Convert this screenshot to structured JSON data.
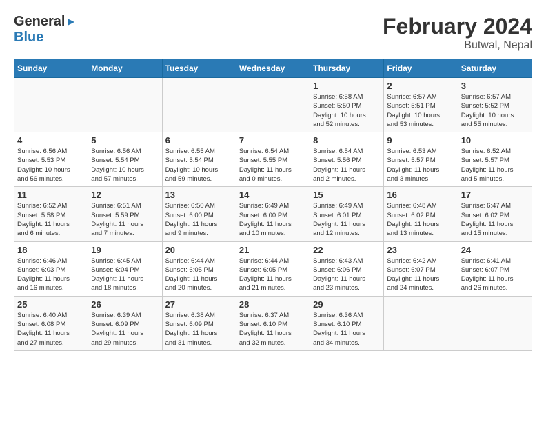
{
  "header": {
    "logo_line1": "General",
    "logo_line2": "Blue",
    "title": "February 2024",
    "subtitle": "Butwal, Nepal"
  },
  "days_of_week": [
    "Sunday",
    "Monday",
    "Tuesday",
    "Wednesday",
    "Thursday",
    "Friday",
    "Saturday"
  ],
  "weeks": [
    [
      {
        "day": "",
        "info": ""
      },
      {
        "day": "",
        "info": ""
      },
      {
        "day": "",
        "info": ""
      },
      {
        "day": "",
        "info": ""
      },
      {
        "day": "1",
        "info": "Sunrise: 6:58 AM\nSunset: 5:50 PM\nDaylight: 10 hours\nand 52 minutes."
      },
      {
        "day": "2",
        "info": "Sunrise: 6:57 AM\nSunset: 5:51 PM\nDaylight: 10 hours\nand 53 minutes."
      },
      {
        "day": "3",
        "info": "Sunrise: 6:57 AM\nSunset: 5:52 PM\nDaylight: 10 hours\nand 55 minutes."
      }
    ],
    [
      {
        "day": "4",
        "info": "Sunrise: 6:56 AM\nSunset: 5:53 PM\nDaylight: 10 hours\nand 56 minutes."
      },
      {
        "day": "5",
        "info": "Sunrise: 6:56 AM\nSunset: 5:54 PM\nDaylight: 10 hours\nand 57 minutes."
      },
      {
        "day": "6",
        "info": "Sunrise: 6:55 AM\nSunset: 5:54 PM\nDaylight: 10 hours\nand 59 minutes."
      },
      {
        "day": "7",
        "info": "Sunrise: 6:54 AM\nSunset: 5:55 PM\nDaylight: 11 hours\nand 0 minutes."
      },
      {
        "day": "8",
        "info": "Sunrise: 6:54 AM\nSunset: 5:56 PM\nDaylight: 11 hours\nand 2 minutes."
      },
      {
        "day": "9",
        "info": "Sunrise: 6:53 AM\nSunset: 5:57 PM\nDaylight: 11 hours\nand 3 minutes."
      },
      {
        "day": "10",
        "info": "Sunrise: 6:52 AM\nSunset: 5:57 PM\nDaylight: 11 hours\nand 5 minutes."
      }
    ],
    [
      {
        "day": "11",
        "info": "Sunrise: 6:52 AM\nSunset: 5:58 PM\nDaylight: 11 hours\nand 6 minutes."
      },
      {
        "day": "12",
        "info": "Sunrise: 6:51 AM\nSunset: 5:59 PM\nDaylight: 11 hours\nand 7 minutes."
      },
      {
        "day": "13",
        "info": "Sunrise: 6:50 AM\nSunset: 6:00 PM\nDaylight: 11 hours\nand 9 minutes."
      },
      {
        "day": "14",
        "info": "Sunrise: 6:49 AM\nSunset: 6:00 PM\nDaylight: 11 hours\nand 10 minutes."
      },
      {
        "day": "15",
        "info": "Sunrise: 6:49 AM\nSunset: 6:01 PM\nDaylight: 11 hours\nand 12 minutes."
      },
      {
        "day": "16",
        "info": "Sunrise: 6:48 AM\nSunset: 6:02 PM\nDaylight: 11 hours\nand 13 minutes."
      },
      {
        "day": "17",
        "info": "Sunrise: 6:47 AM\nSunset: 6:02 PM\nDaylight: 11 hours\nand 15 minutes."
      }
    ],
    [
      {
        "day": "18",
        "info": "Sunrise: 6:46 AM\nSunset: 6:03 PM\nDaylight: 11 hours\nand 16 minutes."
      },
      {
        "day": "19",
        "info": "Sunrise: 6:45 AM\nSunset: 6:04 PM\nDaylight: 11 hours\nand 18 minutes."
      },
      {
        "day": "20",
        "info": "Sunrise: 6:44 AM\nSunset: 6:05 PM\nDaylight: 11 hours\nand 20 minutes."
      },
      {
        "day": "21",
        "info": "Sunrise: 6:44 AM\nSunset: 6:05 PM\nDaylight: 11 hours\nand 21 minutes."
      },
      {
        "day": "22",
        "info": "Sunrise: 6:43 AM\nSunset: 6:06 PM\nDaylight: 11 hours\nand 23 minutes."
      },
      {
        "day": "23",
        "info": "Sunrise: 6:42 AM\nSunset: 6:07 PM\nDaylight: 11 hours\nand 24 minutes."
      },
      {
        "day": "24",
        "info": "Sunrise: 6:41 AM\nSunset: 6:07 PM\nDaylight: 11 hours\nand 26 minutes."
      }
    ],
    [
      {
        "day": "25",
        "info": "Sunrise: 6:40 AM\nSunset: 6:08 PM\nDaylight: 11 hours\nand 27 minutes."
      },
      {
        "day": "26",
        "info": "Sunrise: 6:39 AM\nSunset: 6:09 PM\nDaylight: 11 hours\nand 29 minutes."
      },
      {
        "day": "27",
        "info": "Sunrise: 6:38 AM\nSunset: 6:09 PM\nDaylight: 11 hours\nand 31 minutes."
      },
      {
        "day": "28",
        "info": "Sunrise: 6:37 AM\nSunset: 6:10 PM\nDaylight: 11 hours\nand 32 minutes."
      },
      {
        "day": "29",
        "info": "Sunrise: 6:36 AM\nSunset: 6:10 PM\nDaylight: 11 hours\nand 34 minutes."
      },
      {
        "day": "",
        "info": ""
      },
      {
        "day": "",
        "info": ""
      }
    ]
  ]
}
